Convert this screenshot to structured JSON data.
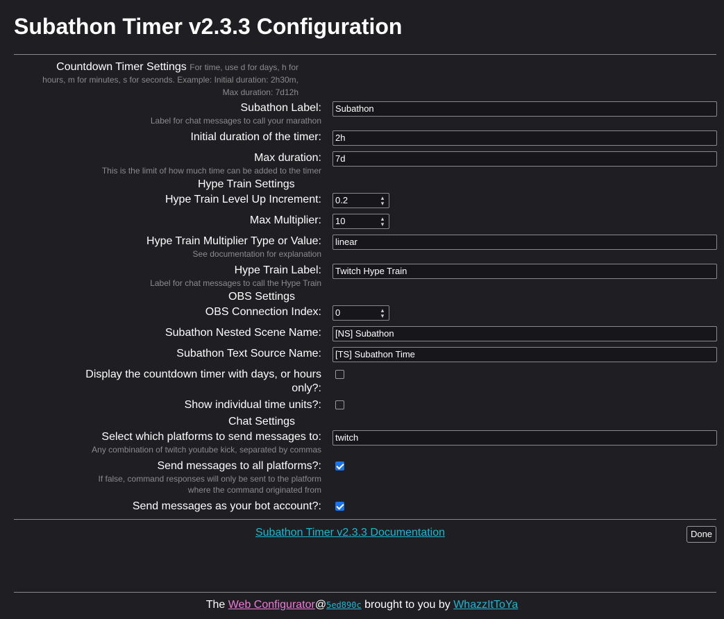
{
  "header": {
    "title": "Subathon Timer v2.3.3 Configuration"
  },
  "countdown": {
    "title": "Countdown Timer Settings",
    "hint": "For time, use d for days, h for hours, m for minutes, s for seconds. Example: Initial duration: 2h30m, Max duration: 7d12h",
    "subathon_label": {
      "label": "Subathon Label:",
      "hint": "Label for chat messages to call your marathon",
      "value": "Subathon"
    },
    "initial_duration": {
      "label": "Initial duration of the timer:",
      "value": "2h"
    },
    "max_duration": {
      "label": "Max duration:",
      "hint": "This is the limit of how much time can be added to the timer",
      "value": "7d"
    }
  },
  "hype": {
    "title": "Hype Train Settings",
    "level_up": {
      "label": "Hype Train Level Up Increment:",
      "value": "0.2"
    },
    "max_multiplier": {
      "label": "Max Multiplier:",
      "value": "10"
    },
    "multiplier_type": {
      "label": "Hype Train Multiplier Type or Value:",
      "hint": "See documentation for explanation",
      "value": "linear"
    },
    "label": {
      "label": "Hype Train Label:",
      "hint": "Label for chat messages to call the Hype Train",
      "value": "Twitch Hype Train"
    }
  },
  "obs": {
    "title": "OBS Settings",
    "connection_index": {
      "label": "OBS Connection Index:",
      "value": "0"
    },
    "nested_scene": {
      "label": "Subathon Nested Scene Name:",
      "value": "[NS] Subathon"
    },
    "text_source": {
      "label": "Subathon Text Source Name:",
      "value": "[TS] Subathon Time"
    },
    "days_or_hours": {
      "label_line1": "Display the countdown timer with days, or hours",
      "label_line2": "only?:",
      "checked": false
    },
    "individual_units": {
      "label": "Show individual time units?:",
      "checked": false
    }
  },
  "chat": {
    "title": "Chat Settings",
    "platforms": {
      "label": "Select which platforms to send messages to:",
      "hint": "Any combination of twitch youtube kick, separated by commas",
      "value": "twitch"
    },
    "all_platforms": {
      "label": "Send messages to all platforms?:",
      "hint_line1": "If false, command responses will only be sent to the platform",
      "hint_line2": "where the command originated from",
      "checked": true
    },
    "bot_account": {
      "label": "Send messages as your bot account?:",
      "checked": true
    }
  },
  "docs_link": "Subathon Timer v2.3.3 Documentation",
  "done_button": "Done",
  "footer": {
    "prefix": "The ",
    "web_configurator": "Web Configurator",
    "at": "@",
    "commit": "5ed890c",
    "middle": " brought to you by ",
    "author": "WhazzItToYa"
  },
  "colors": {
    "background": "#1e1e23",
    "link": "#1fb7d0",
    "pink_link": "#f07bd6",
    "checkbox_on": "#1a73e8"
  }
}
